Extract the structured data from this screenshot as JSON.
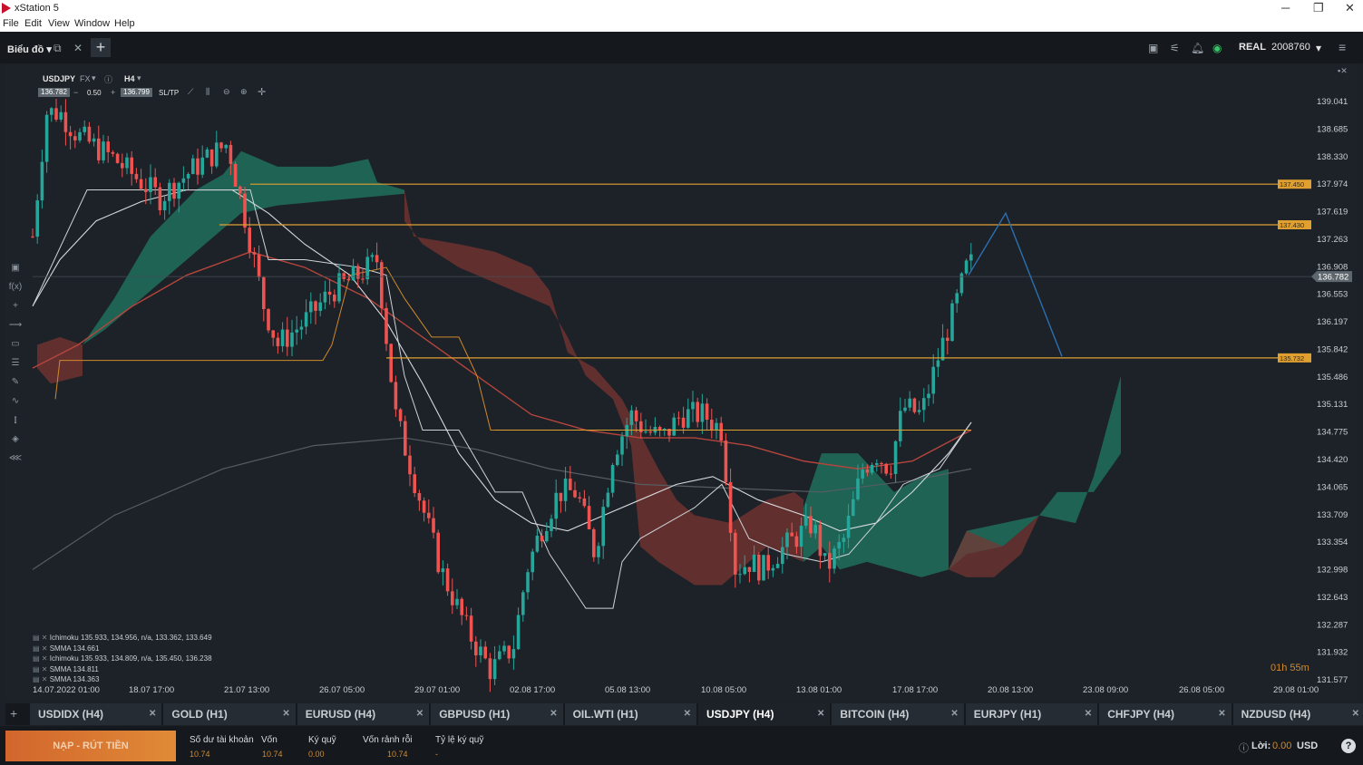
{
  "window": {
    "title": "xStation 5",
    "menu": [
      "File",
      "Edit",
      "View",
      "Window",
      "Help"
    ]
  },
  "toolbar": {
    "tab_label": "Biểu đồ",
    "account_type": "REAL",
    "account_id": "2008760"
  },
  "chart": {
    "symbol": "USDJPY",
    "type": "FX",
    "timeframe": "H4",
    "bid": "136.782",
    "spread": "0.50",
    "ask": "136.799",
    "sltp": "SL/TP",
    "countdown": "01h 55m"
  },
  "chart_data": {
    "type": "candlestick",
    "symbol": "USDJPY",
    "timeframe": "H4",
    "y_ticks": [
      "139.041",
      "138.685",
      "138.330",
      "137.974",
      "137.619",
      "137.263",
      "136.908",
      "136.553",
      "136.197",
      "135.842",
      "135.486",
      "135.131",
      "134.775",
      "134.420",
      "134.065",
      "133.709",
      "133.354",
      "132.998",
      "132.643",
      "132.287",
      "131.932",
      "131.577"
    ],
    "x_ticks": [
      "14.07.2022 01:00",
      "18.07 17:00",
      "21.07 13:00",
      "26.07 05:00",
      "29.07 01:00",
      "02.08 17:00",
      "05.08 13:00",
      "10.08 05:00",
      "13.08 01:00",
      "17.08 17:00",
      "20.08 13:00",
      "23.08 09:00",
      "26.08 05:00",
      "29.08 01:00"
    ],
    "current_price": "136.782",
    "horizontal_lines": [
      {
        "label": "137.450",
        "value": 137.45
      },
      {
        "label": "137.430",
        "value": 137.43
      },
      {
        "label": "135.732",
        "value": 135.732
      }
    ],
    "indicators": [
      "Ichimoku 135.933, 134.956, n/a, 133.362, 133.649",
      "SMMA 134.661",
      "Ichimoku 135.933, 134.809, n/a, 135.450, 136.238",
      "SMMA 134.811",
      "SMMA 134.363"
    ],
    "ylim": [
      131.4,
      139.3
    ]
  },
  "tabs": [
    {
      "label": "USDIDX (H4)"
    },
    {
      "label": "GOLD (H1)"
    },
    {
      "label": "EURUSD (H4)"
    },
    {
      "label": "GBPUSD (H1)"
    },
    {
      "label": "OIL.WTI (H1)"
    },
    {
      "label": "USDJPY (H4)",
      "active": true
    },
    {
      "label": "BITCOIN (H4)"
    },
    {
      "label": "EURJPY (H1)"
    },
    {
      "label": "CHFJPY (H4)"
    },
    {
      "label": "NZDUSD (H4)"
    }
  ],
  "footer": {
    "deposit_label": "NẠP - RÚT TIỀN",
    "balance_label": "Số dư tài khoản",
    "balance": "10.74",
    "equity_label": "Vốn",
    "equity": "10.74",
    "margin_label": "Ký quỹ",
    "margin": "0.00",
    "free_margin_label": "Vốn rảnh rỗi",
    "free_margin": "10.74",
    "margin_level_label": "Tỷ lệ ký quỹ",
    "margin_level": "-",
    "profit_label": "Lời:",
    "profit": "0.00",
    "currency": "USD"
  },
  "colors": {
    "bull": "#26a69a",
    "bear": "#ef5350",
    "cloud_green": "#1f7a63",
    "cloud_red": "#7a3432",
    "level_line": "#e0a030",
    "projection": "#2d6fb0"
  }
}
